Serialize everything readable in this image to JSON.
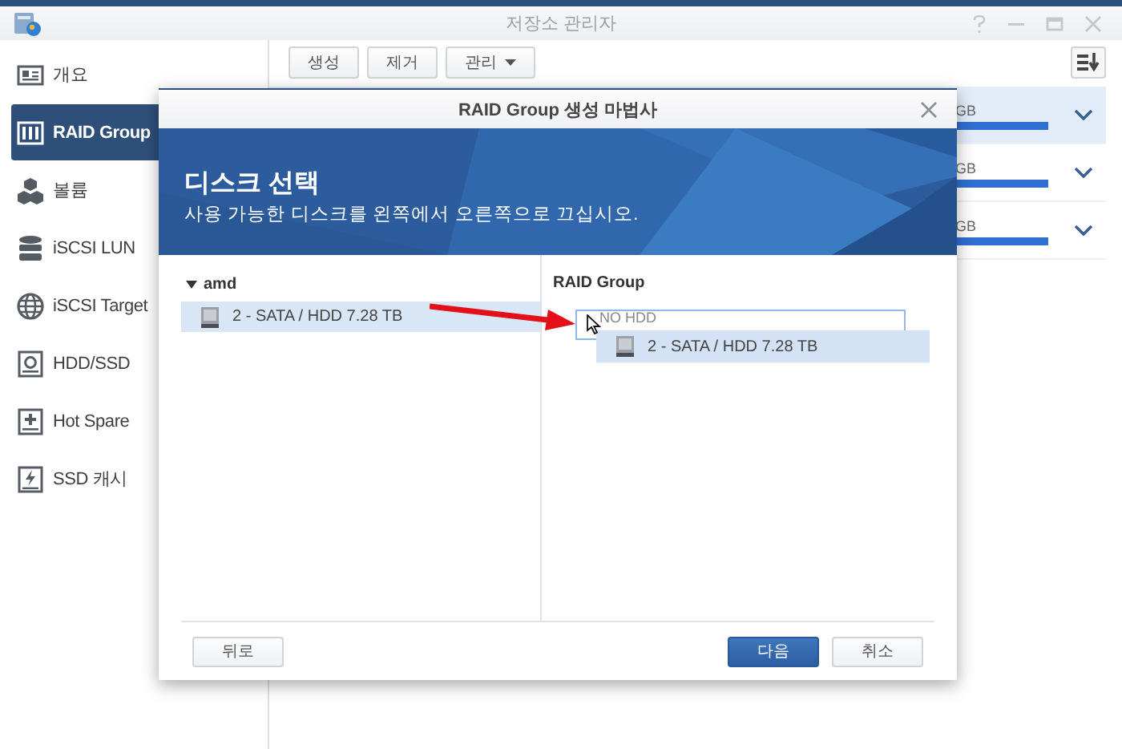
{
  "window": {
    "title": "저장소 관리자"
  },
  "sidebar": {
    "items": [
      {
        "label": "개요",
        "selected": false
      },
      {
        "label": "RAID Group",
        "selected": true
      },
      {
        "label": "볼륨",
        "selected": false
      },
      {
        "label": "iSCSI LUN",
        "selected": false
      },
      {
        "label": "iSCSI Target",
        "selected": false
      },
      {
        "label": "HDD/SSD",
        "selected": false
      },
      {
        "label": "Hot Spare",
        "selected": false
      },
      {
        "label": "SSD 캐시",
        "selected": false
      }
    ]
  },
  "toolbar": {
    "buttons": [
      {
        "label": "생성",
        "dropdown": false
      },
      {
        "label": "제거",
        "dropdown": false
      },
      {
        "label": "관리",
        "dropdown": true
      }
    ]
  },
  "list": {
    "rows": [
      {
        "size": "GB",
        "selected": true
      },
      {
        "size": "GB",
        "selected": false
      },
      {
        "size": "GB",
        "selected": false
      }
    ]
  },
  "dialog": {
    "title": "RAID Group 생성 마법사",
    "heading": "디스크 선택",
    "subtitle": "사용 가능한 디스크를 왼쪽에서 오른쪽으로 끄십시오.",
    "available": {
      "group": "amd",
      "expanded": true,
      "disks": [
        {
          "label": "2 - SATA / HDD 7.28 TB",
          "selected": true
        }
      ]
    },
    "target": {
      "title": "RAID Group",
      "placeholder": "NO HDD"
    },
    "dragging": {
      "label": "2 - SATA / HDD 7.28 TB"
    },
    "buttons": [
      {
        "label": "뒤로",
        "primary": false
      },
      {
        "label": "다음",
        "primary": true
      },
      {
        "label": "취소",
        "primary": false
      }
    ]
  }
}
